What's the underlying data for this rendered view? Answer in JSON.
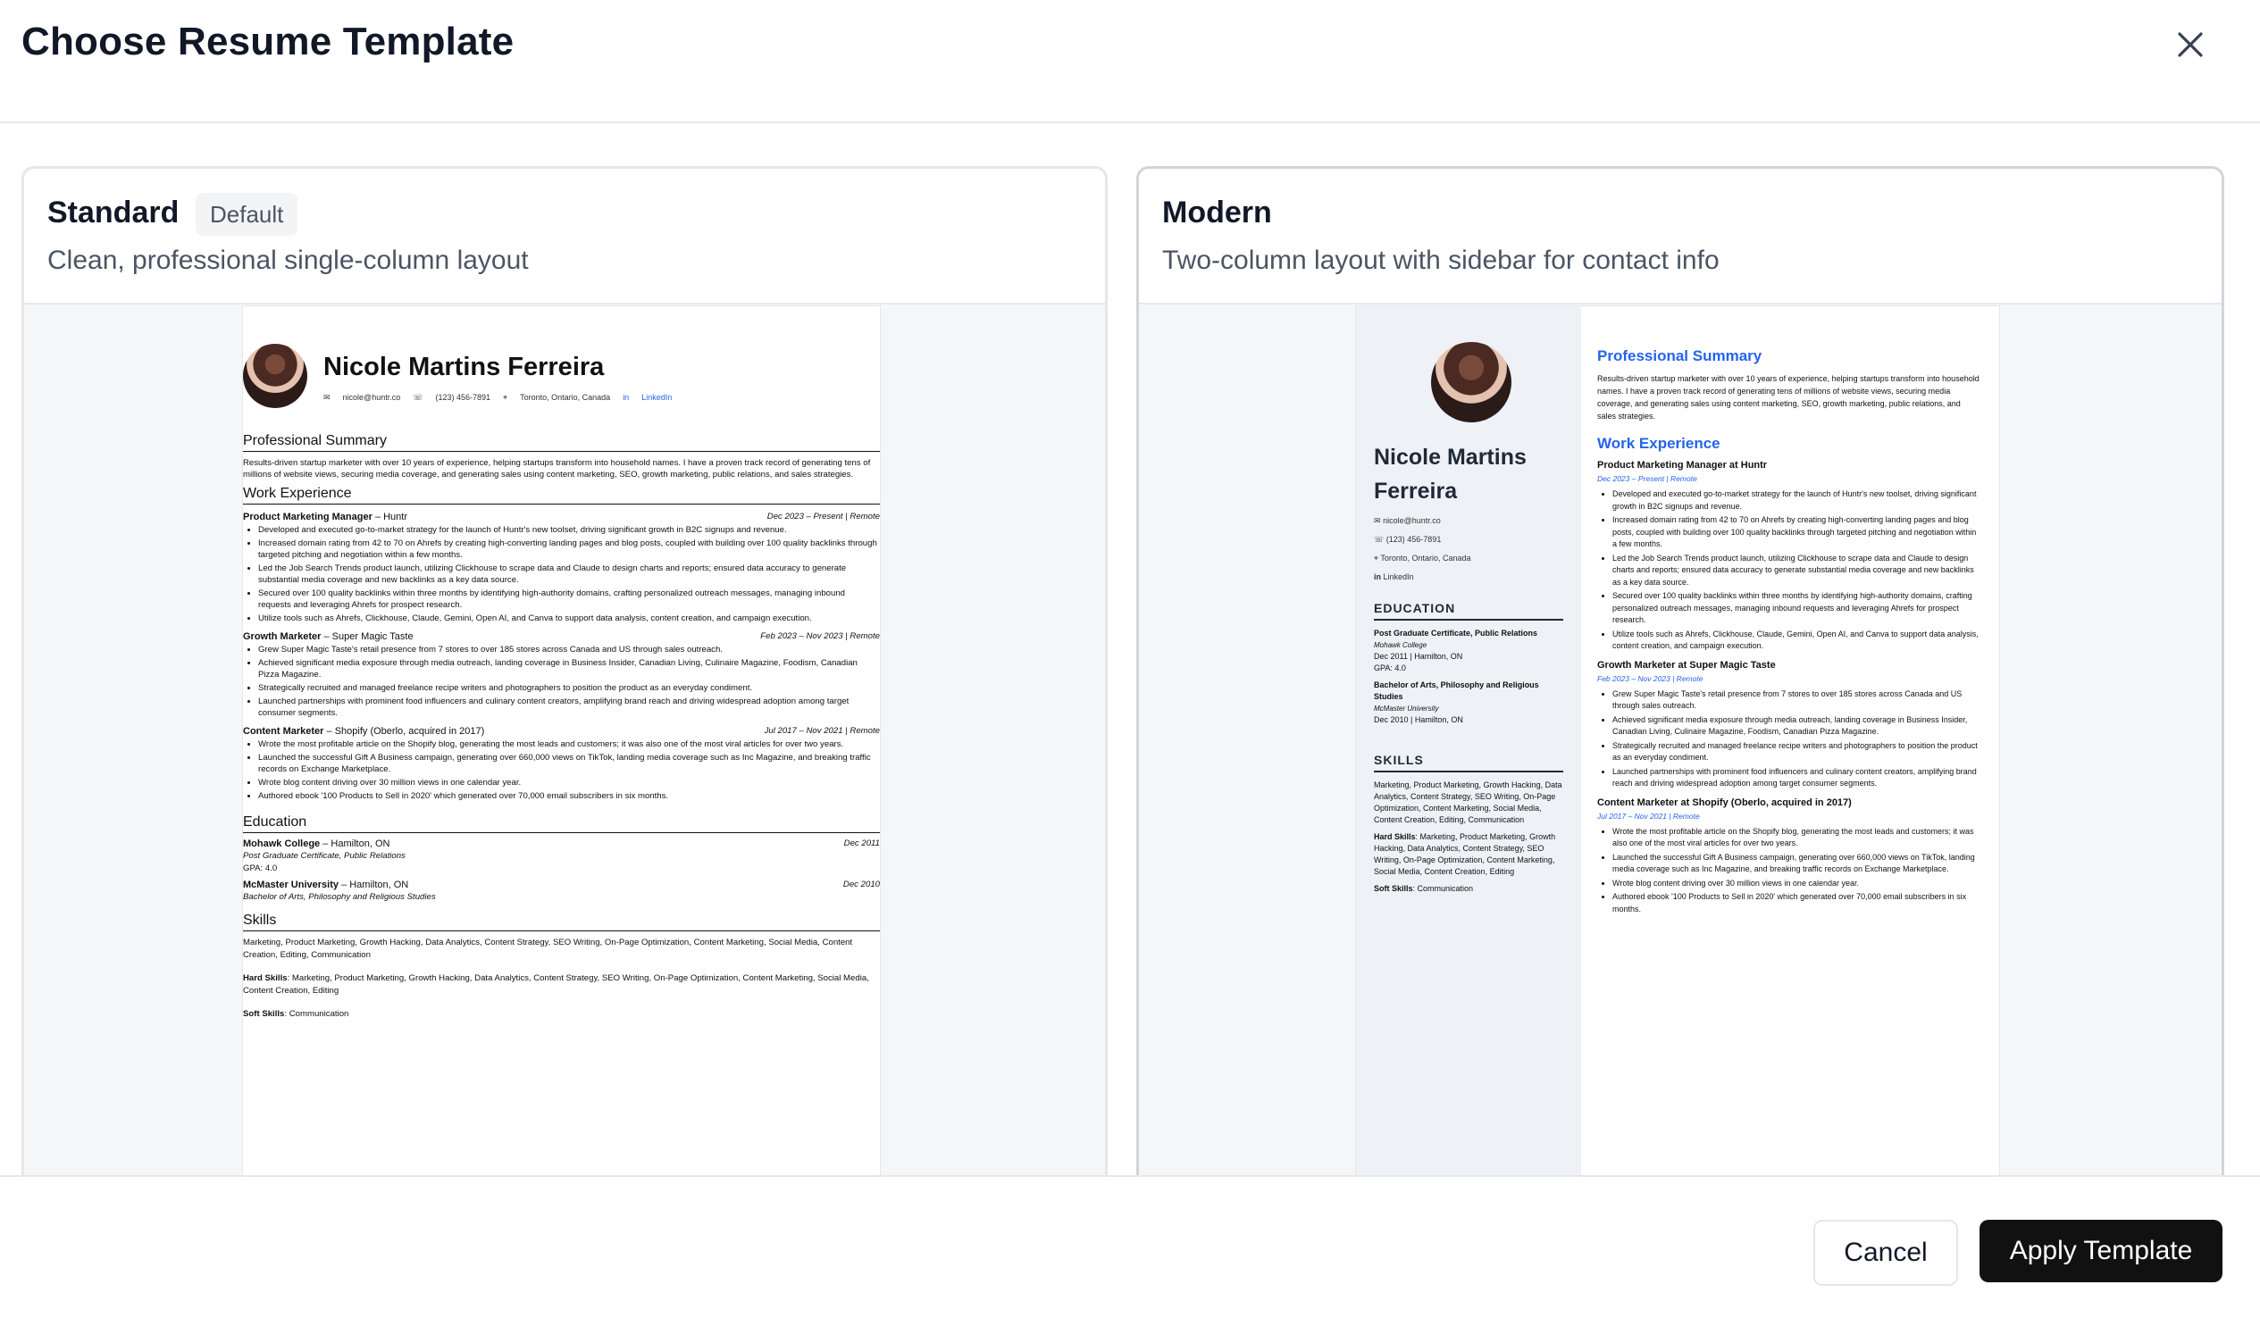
{
  "dialog": {
    "title": "Choose Resume Template",
    "close_icon": "close-icon"
  },
  "templates": [
    {
      "name": "Standard",
      "badge": "Default",
      "description": "Clean, professional single-column layout"
    },
    {
      "name": "Modern",
      "badge": "",
      "description": "Two-column layout with sidebar for contact info"
    }
  ],
  "resume": {
    "name": "Nicole Martins Ferreira",
    "name_line1": "Nicole Martins",
    "name_line2": "Ferreira",
    "email": "nicole@huntr.co",
    "phone": "(123) 456-7891",
    "location": "Toronto, Ontario, Canada",
    "linkedin": "LinkedIn",
    "summary_title": "Professional Summary",
    "summary": "Results-driven startup marketer with over 10 years of experience, helping startups transform into household names. I have a proven track record of generating tens of millions of website views, securing media coverage, and generating sales using content marketing, SEO, growth marketing, public relations, and sales strategies.",
    "work_title": "Work Experience",
    "jobs": [
      {
        "role": "Product Marketing Manager",
        "company": "– Huntr",
        "modern_title": "Product Marketing Manager at Huntr",
        "dates": "Dec 2023 – Present  |  Remote",
        "bullets": [
          "Developed and executed go-to-market strategy for the launch of Huntr's new toolset, driving significant growth in B2C signups and revenue.",
          "Increased domain rating from 42 to 70 on Ahrefs by creating high-converting landing pages and blog posts, coupled with building over 100 quality backlinks through targeted pitching and negotiation within a few months.",
          "Led the Job Search Trends product launch, utilizing Clickhouse to scrape data and Claude to design charts and reports; ensured data accuracy to generate substantial media coverage and new backlinks as a key data source.",
          "Secured over 100 quality backlinks within three months by identifying high-authority domains, crafting personalized outreach messages, managing inbound requests and leveraging Ahrefs for prospect research.",
          "Utilize tools such as Ahrefs, Clickhouse, Claude, Gemini, Open AI, and Canva to support data analysis, content creation, and campaign execution."
        ]
      },
      {
        "role": "Growth Marketer",
        "company": "– Super Magic Taste",
        "modern_title": "Growth Marketer at Super Magic Taste",
        "dates": "Feb 2023 – Nov 2023  |  Remote",
        "bullets": [
          "Grew Super Magic Taste's retail presence from 7 stores to over 185 stores across Canada and US through sales outreach.",
          "Achieved significant media exposure through media outreach, landing coverage in Business Insider, Canadian Living, Culinaire Magazine, Foodism, Canadian Pizza Magazine.",
          "Strategically recruited and managed freelance recipe writers and photographers to position the product as an everyday condiment.",
          "Launched partnerships with prominent food influencers and culinary content creators, amplifying brand reach and driving widespread adoption among target consumer segments."
        ]
      },
      {
        "role": "Content Marketer",
        "company": "– Shopify (Oberlo, acquired in 2017)",
        "modern_title": "Content Marketer at Shopify (Oberlo, acquired in 2017)",
        "dates": "Jul 2017 – Nov 2021  |  Remote",
        "bullets": [
          "Wrote the most profitable article on the Shopify blog, generating the most leads and customers; it was also one of the most viral articles for over two years.",
          "Launched the successful Gift A Business campaign, generating over 660,000 views on TikTok, landing media coverage such as Inc Magazine, and breaking traffic records on Exchange Marketplace.",
          "Wrote blog content driving over 30 million views in one calendar year.",
          "Authored ebook '100 Products to Sell in 2020' which generated over 70,000 email subscribers in six months."
        ]
      }
    ],
    "education_title": "Education",
    "education_title_upper": "EDUCATION",
    "education": [
      {
        "school": "Mohawk College",
        "city": "– Hamilton, ON",
        "degree": "Post Graduate Certificate, Public Relations",
        "date": "Dec 2011",
        "extra": "GPA: 4.0",
        "modern_meta": "Dec 2011  |  Hamilton, ON"
      },
      {
        "school": "McMaster University",
        "city": "– Hamilton, ON",
        "degree": "Bachelor of Arts, Philosophy and Religious Studies",
        "date": "Dec 2010",
        "extra": "",
        "modern_meta": "Dec 2010  |  Hamilton, ON"
      }
    ],
    "skills_title": "Skills",
    "skills_title_upper": "SKILLS",
    "skills": "Marketing, Product Marketing, Growth Hacking, Data Analytics, Content Strategy, SEO Writing, On-Page Optimization, Content Marketing, Social Media, Content Creation, Editing, Communication",
    "hard_skills_label": "Hard Skills",
    "hard_skills": ": Marketing, Product Marketing, Growth Hacking, Data Analytics, Content Strategy, SEO Writing, On-Page Optimization, Content Marketing, Social Media, Content Creation, Editing",
    "soft_skills_label": "Soft Skills",
    "soft_skills": ": Communication"
  },
  "footer": {
    "cancel_label": "Cancel",
    "apply_label": "Apply Template"
  }
}
